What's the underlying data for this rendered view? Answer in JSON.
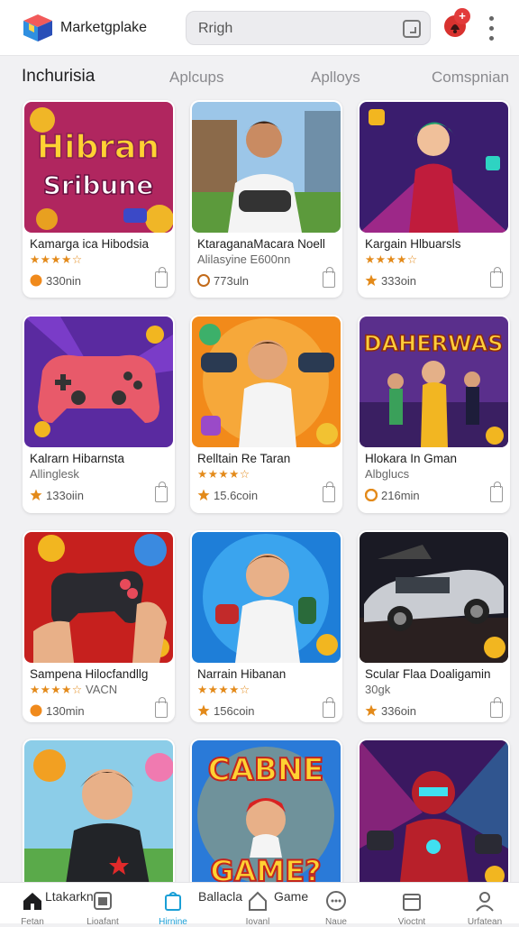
{
  "header": {
    "brand": "Marketgplake",
    "search_value": "Rrigh",
    "notification_count": "+"
  },
  "tabs": [
    {
      "label": "Inchurisia",
      "active": true
    },
    {
      "label": "Aplcups",
      "active": false
    },
    {
      "label": "Aplloys",
      "active": false
    },
    {
      "label": "Comspnian",
      "active": false
    }
  ],
  "cards": [
    {
      "title": "Kamarga ica Hibodsia",
      "subtitle": "",
      "rating": "★★★★☆",
      "price": "330nin",
      "art_text": [
        "Hibran",
        "Sribune"
      ]
    },
    {
      "title": "KtaraganaMacara Noell",
      "subtitle": "Alilasyine E600nn",
      "rating": "",
      "price": "773uln",
      "art_text": []
    },
    {
      "title": "Kargain Hlbuarsls",
      "subtitle": "",
      "rating": "★★★★☆",
      "price": "333oin",
      "art_text": []
    },
    {
      "title": "Kalrarn Hibarnsta",
      "subtitle": "Allinglesk",
      "rating": "",
      "price": "133oiin",
      "art_text": []
    },
    {
      "title": "Relltain Re Taran",
      "subtitle": "",
      "rating": "★★★★☆",
      "price": "15.6coin",
      "art_text": []
    },
    {
      "title": "Hlokara In Gman",
      "subtitle": "Albglucs",
      "rating": "",
      "price": "216min",
      "art_text": [
        "DAHERWAS"
      ]
    },
    {
      "title": "Sampena Hilocfandllg",
      "subtitle": "VACN",
      "rating": "★★★★☆",
      "price": "130min",
      "art_text": []
    },
    {
      "title": "Narrain Hibanan",
      "subtitle": "",
      "rating": "★★★★☆",
      "price": "156coin",
      "art_text": []
    },
    {
      "title": "Scular Flaa Doaligamin",
      "subtitle": "30gk",
      "rating": "",
      "price": "336oin",
      "art_text": []
    },
    {
      "title": "",
      "subtitle": "",
      "rating": "",
      "price": "",
      "art_text": []
    },
    {
      "title": "",
      "subtitle": "",
      "rating": "",
      "price": "",
      "art_text": [
        "CABNE",
        "GAME?"
      ]
    },
    {
      "title": "",
      "subtitle": "",
      "rating": "",
      "price": "",
      "art_text": []
    }
  ],
  "bottom_nav": [
    {
      "label": "Fetan",
      "icon": "home-icon",
      "active": false
    },
    {
      "label": "Lioafant",
      "icon": "store-icon",
      "active": false
    },
    {
      "label": "Hirnine",
      "icon": "bag-icon",
      "active": true
    },
    {
      "label": "Iovanl",
      "icon": "house-icon",
      "active": false
    },
    {
      "label": "Naue",
      "icon": "chat-icon",
      "active": false
    },
    {
      "label": "Vioctnt",
      "icon": "box-icon",
      "active": false
    },
    {
      "label": "Urfatean",
      "icon": "person-icon",
      "active": false
    }
  ],
  "nav_overlay": {
    "left_text": "Ltakarkn",
    "middle_text": "Ballacla",
    "right_text": "Game"
  },
  "colors": {
    "accent": "#1a9fd6",
    "star": "#e38a1a",
    "badge": "#e23b3b"
  }
}
